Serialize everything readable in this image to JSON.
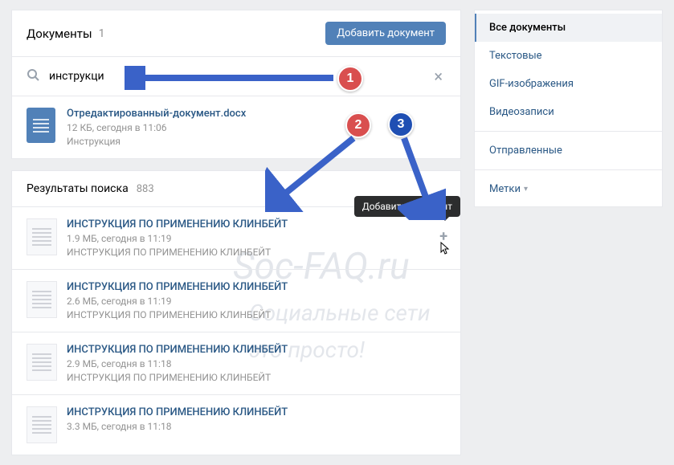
{
  "header": {
    "title": "Документы",
    "count": "1",
    "add_btn": "Добавить документ"
  },
  "search": {
    "value": "инструкци"
  },
  "own_doc": {
    "title": "Отредактированный-документ.docx",
    "meta": "12 КБ, сегодня в 11:06",
    "tag": "Инструкция"
  },
  "results": {
    "title": "Результаты поиска",
    "count": "883",
    "tooltip": "Добавить документ",
    "items": [
      {
        "title": "ИНСТРУКЦИЯ ПО ПРИМЕНЕНИЮ КЛИНБЕЙТ",
        "meta": "1.9 МБ, сегодня в 11:19",
        "desc": "ИНСТРУКЦИЯ ПО ПРИМЕНЕНИЮ КЛИНБЕЙТ"
      },
      {
        "title": "ИНСТРУКЦИЯ ПО ПРИМЕНЕНИЮ КЛИНБЕЙТ",
        "meta": "2.6 МБ, сегодня в 11:19",
        "desc": "ИНСТРУКЦИЯ ПО ПРИМЕНЕНИЮ КЛИНБЕЙТ"
      },
      {
        "title": "ИНСТРУКЦИЯ ПО ПРИМЕНЕНИЮ КЛИНБЕЙТ",
        "meta": "2.9 МБ, сегодня в 11:18",
        "desc": "ИНСТРУКЦИЯ ПО ПРИМЕНЕНИЮ КЛИНБЕЙТ"
      },
      {
        "title": "ИНСТРУКЦИЯ ПО ПРИМЕНЕНИЮ КЛИНБЕЙТ",
        "meta": "3.3 МБ, сегодня в 11:18",
        "desc": ""
      }
    ]
  },
  "sidebar": {
    "items": [
      {
        "label": "Все документы",
        "active": true
      },
      {
        "label": "Текстовые"
      },
      {
        "label": "GIF-изображения"
      },
      {
        "label": "Видеозаписи"
      }
    ],
    "sent": "Отправленные",
    "labels": "Метки"
  },
  "annot": {
    "b1": "1",
    "b2": "2",
    "b3": "3"
  },
  "watermark": {
    "line1": "Soc-FAQ.ru",
    "line2": "Социальные сети",
    "line3": "это просто!"
  }
}
